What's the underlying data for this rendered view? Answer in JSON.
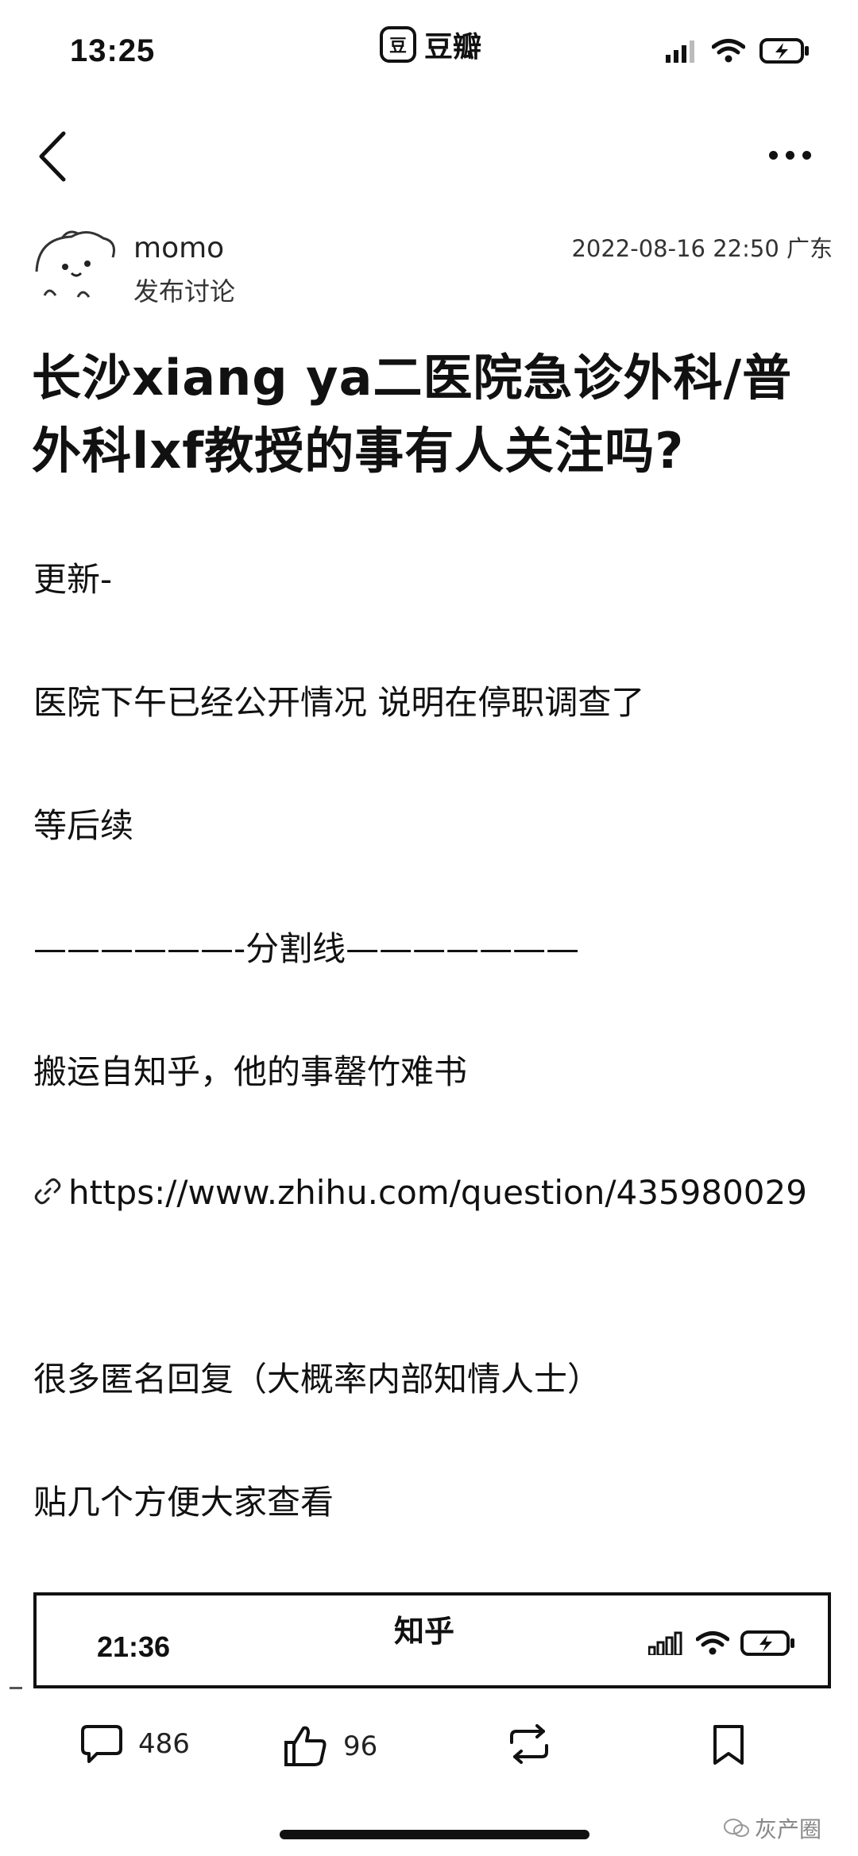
{
  "status_bar": {
    "time": "13:25",
    "app_name": "豆瓣",
    "app_icon_glyph": "豆",
    "icons": [
      "signal-icon",
      "wifi-icon",
      "battery-charging-icon"
    ]
  },
  "nav": {
    "back_icon": "chevron-left-icon",
    "more_icon": "more-dots-icon"
  },
  "author": {
    "name": "momo",
    "action": "发布讨论",
    "datetime": "2022-08-16 22:50",
    "location": "广东"
  },
  "post": {
    "title": "长沙xiang ya二医院急诊外科/普外科lxf教授的事有人关注吗?",
    "paragraphs": [
      "更新-",
      "医院下午已经公开情况 说明在停职调查了",
      "等后续",
      "——————-分割线———————",
      "搬运自知乎，他的事罄竹难书",
      "https://www.zhihu.com/question/435980029",
      "很多匿名回复（大概率内部知情人士）",
      "贴几个方便大家查看"
    ]
  },
  "embedded_screenshot": {
    "time": "21:36",
    "app_title": "知乎"
  },
  "actions": {
    "comments": "486",
    "likes": "96"
  },
  "watermark": {
    "text": "灰产圈"
  },
  "colors": {
    "text": "#111111",
    "background": "#ffffff"
  }
}
